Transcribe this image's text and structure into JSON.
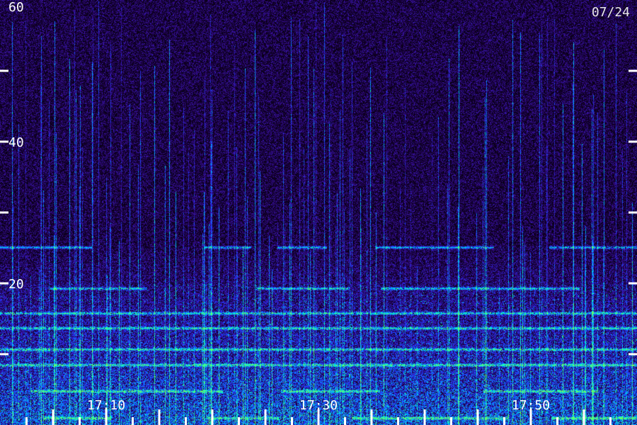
{
  "chart_data": {
    "type": "heatmap",
    "title": "",
    "xlabel": "",
    "ylabel": "",
    "date_label": "07/24",
    "ylim": [
      0,
      60
    ],
    "y_tick_values": [
      0,
      10,
      20,
      30,
      40,
      50,
      60
    ],
    "y_tick_labels": [
      {
        "value": 60,
        "text": "60"
      },
      {
        "value": 40,
        "text": "40"
      },
      {
        "value": 20,
        "text": "20"
      }
    ],
    "x_minutes_range": [
      1020,
      1080
    ],
    "x_tick_labels": [
      {
        "minutes": 1030,
        "text": "17:10"
      },
      {
        "minutes": 1050,
        "text": "17:30"
      },
      {
        "minutes": 1070,
        "text": "17:50"
      }
    ],
    "x_minor_tick_step_minutes": 2.5,
    "colormap": [
      "#000000",
      "#1a0040",
      "#3a12a0",
      "#2233ff",
      "#00aaff",
      "#00ffcc",
      "#66ff66"
    ],
    "background_noise_color": "#2a0a6a",
    "horizontal_bands": [
      {
        "y": 25.1,
        "color": "#00e0ff",
        "extent": "partial"
      },
      {
        "y": 19.3,
        "color": "#22ffdd",
        "extent": "partial"
      },
      {
        "y": 15.8,
        "color": "#1144ff",
        "extent": "full"
      },
      {
        "y": 13.7,
        "color": "#22aaff",
        "extent": "full"
      },
      {
        "y": 10.7,
        "color": "#44ff88",
        "extent": "full"
      },
      {
        "y": 8.5,
        "color": "#33aaff",
        "extent": "full"
      },
      {
        "y": 4.8,
        "color": "#66ff66",
        "extent": "partial"
      },
      {
        "y": 1.0,
        "color": "#33ff99",
        "extent": "partial"
      }
    ]
  }
}
